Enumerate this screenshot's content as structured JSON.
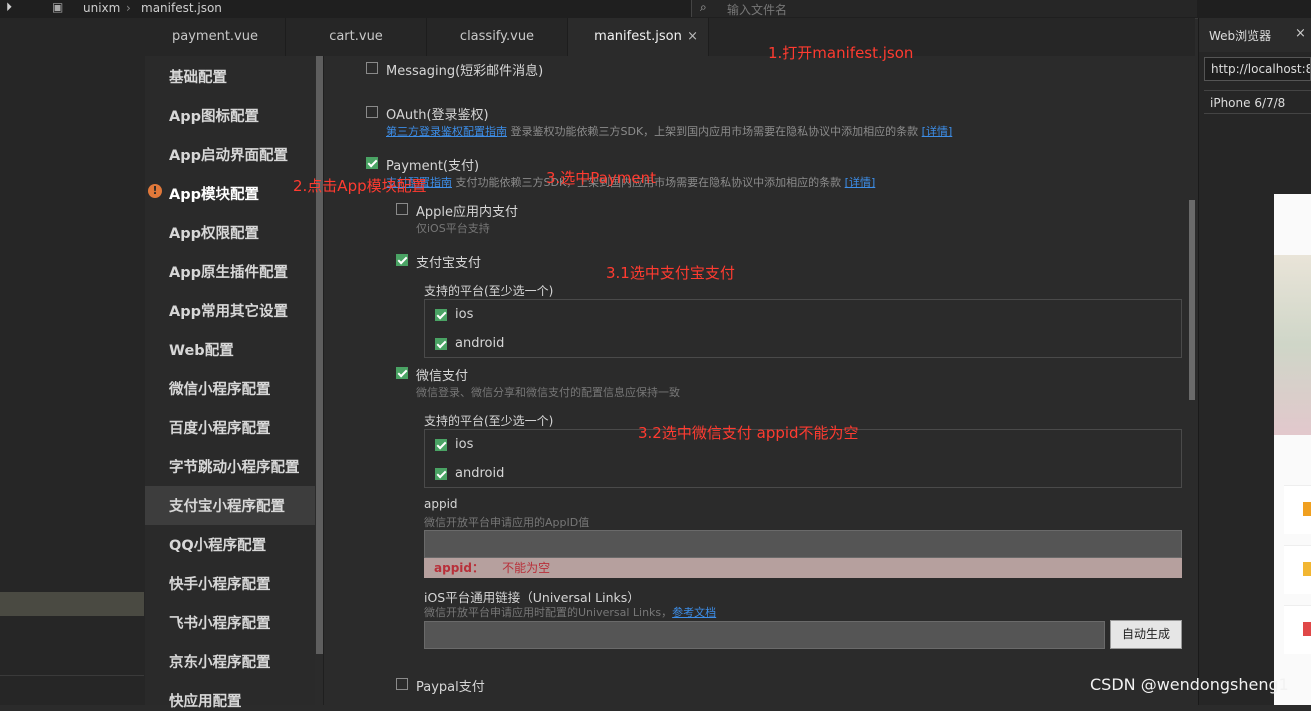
{
  "topbar": {
    "project": "unixm",
    "file": "manifest.json",
    "search_placeholder": "输入文件名"
  },
  "tabs": [
    {
      "label": "payment.vue"
    },
    {
      "label": "cart.vue"
    },
    {
      "label": "classify.vue"
    },
    {
      "label": "manifest.json",
      "close": "×"
    }
  ],
  "nav": {
    "items": [
      "基础配置",
      "App图标配置",
      "App启动界面配置",
      "App模块配置",
      "App权限配置",
      "App原生插件配置",
      "App常用其它设置",
      "Web配置",
      "微信小程序配置",
      "百度小程序配置",
      "字节跳动小程序配置",
      "支付宝小程序配置",
      "QQ小程序配置",
      "快手小程序配置",
      "飞书小程序配置",
      "京东小程序配置",
      "快应用配置"
    ],
    "warning_icon": "!"
  },
  "content": {
    "messaging": "Messaging(短彩邮件消息)",
    "oauth": "OAuth(登录鉴权)",
    "oauth_link": "第三方登录鉴权配置指南",
    "oauth_desc": "登录鉴权功能依赖三方SDK，上架到国内应用市场需要在隐私协议中添加相应的条款",
    "oauth_detail": "[详情]",
    "payment": "Payment(支付)",
    "payment_link": "支付配置指南",
    "payment_desc": "支付功能依赖三方SDK，上架到国内应用市场需要在隐私协议中添加相应的条款",
    "payment_detail": "[详情]",
    "apple_pay": "Apple应用内支付",
    "apple_pay_sub": "仅iOS平台支持",
    "alipay": "支付宝支付",
    "platform_label": "支持的平台(至少选一个)",
    "ios": "ios",
    "android": "android",
    "wechat_pay": "微信支付",
    "wechat_pay_sub": "微信登录、微信分享和微信支付的配置信息应保持一致",
    "appid_label": "appid",
    "appid_sub": "微信开放平台申请应用的AppID值",
    "appid_error_key": "appid：",
    "appid_error_msg": "不能为空",
    "universal_label": "iOS平台通用链接（Universal Links）",
    "universal_sub": "微信开放平台申请应用时配置的Universal Links，",
    "universal_link": "参考文档",
    "auto_generate": "自动生成",
    "paypal": "Paypal支付"
  },
  "annotations": {
    "step1": "1.打开manifest.json",
    "step2": "2.点击App模块配置",
    "step3": "3.选中Payment",
    "step31": "3.1选中支付宝支付",
    "step32": "3.2选中微信支付 appid不能为空"
  },
  "browser": {
    "title": "Web浏览器",
    "close": "×",
    "url": "http://localhost:8",
    "device": "iPhone 6/7/8"
  },
  "watermark": "CSDN @wendongsheng1",
  "colors": {
    "accent": "#4aa364",
    "annotation": "#ff3b30",
    "link": "#3d8ee8"
  }
}
